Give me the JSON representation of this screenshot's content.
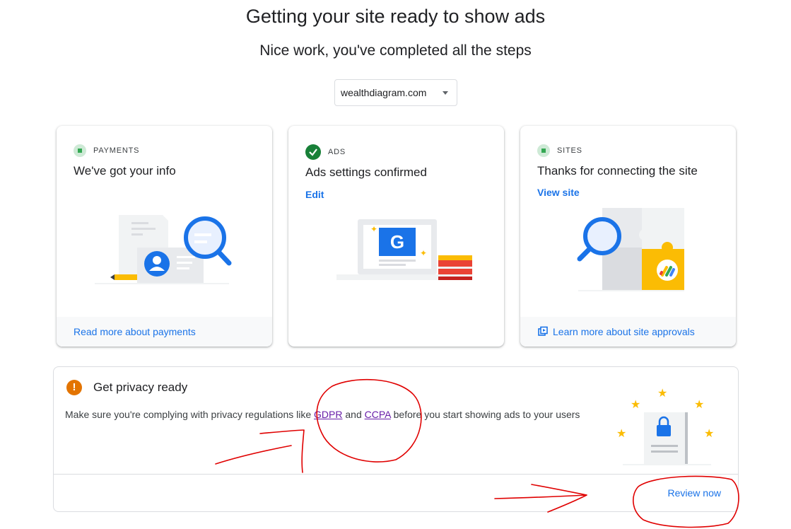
{
  "header": {
    "title": "Getting your site ready to show ads",
    "subtitle": "Nice work, you've completed all the steps"
  },
  "site_selector": {
    "value": "wealthdiagram.com"
  },
  "cards": {
    "payments": {
      "label": "PAYMENTS",
      "heading": "We've got your info",
      "footer_link": "Read more about payments"
    },
    "ads": {
      "label": "ADS",
      "heading": "Ads settings confirmed",
      "link": "Edit",
      "illustration_letter": "G"
    },
    "sites": {
      "label": "SITES",
      "heading": "Thanks for connecting the site",
      "link": "View site",
      "footer_link": "Learn more about site approvals"
    }
  },
  "privacy": {
    "title": "Get privacy ready",
    "desc_before": "Make sure you're complying with privacy regulations like ",
    "gdpr": "GDPR",
    "and": " and ",
    "ccpa": "CCPA",
    "desc_after": " before you start showing ads to your users",
    "review_button": "Review now"
  },
  "colors": {
    "accent": "#1a73e8",
    "success": "#188038",
    "warning": "#e37400",
    "annotation": "#e00000"
  }
}
